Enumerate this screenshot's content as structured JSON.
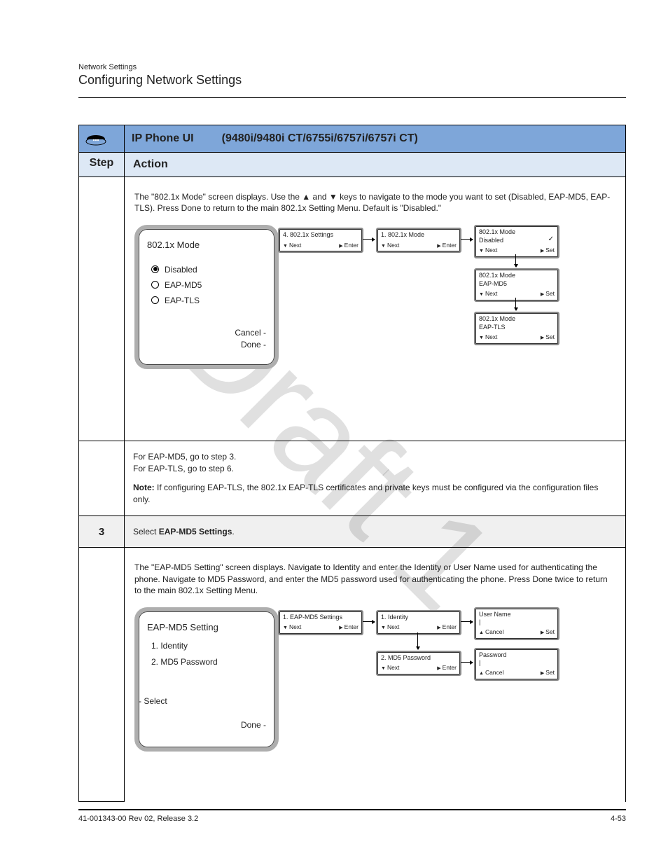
{
  "header": {
    "breadcrumb": "Network Settings",
    "title": "Configuring Network Settings",
    "hr": true
  },
  "table": {
    "mainTitle": "IP Phone UI         (9480i/9480i CT/6755i/6757i/6757i CT)",
    "stepHdr": "Step",
    "actionHdr": "Action"
  },
  "row1": {
    "intro": "The \"802.1x Mode\" screen displays. Use the ▲ and ▼ keys to navigate to the mode you want to set (Disabled, EAP-MD5, EAP-TLS). Press Done to return to the main 802.1x Setting Menu. Default is \"Disabled.\"",
    "screen": {
      "title": "802.1x Mode",
      "opts": [
        "Disabled",
        "EAP-MD5",
        "EAP-TLS"
      ],
      "cancel": "Cancel -",
      "done": "Done -"
    },
    "flow": {
      "n1": {
        "title": "4.  802.1x Settings",
        "l": "Next",
        "r": "Enter"
      },
      "n2": {
        "title": "1.  802.1x Mode",
        "l": "Next",
        "r": "Enter"
      },
      "n3": {
        "title": "802.1x Mode",
        "sub": "Disabled",
        "check": "✓",
        "l": "Next",
        "r": "Set"
      },
      "n4": {
        "title": "802.1x Mode",
        "sub": "EAP-MD5",
        "l": "Next",
        "r": "Set"
      },
      "n5": {
        "title": "802.1x Mode",
        "sub": "EAP-TLS",
        "l": "Next",
        "r": "Set"
      }
    }
  },
  "rowMid": {
    "text": "For EAP-MD5, go to step 3.\nFor EAP-TLS, go to step 6.",
    "noteLead": "Note: ",
    "noteBody": "If configuring EAP-TLS, the 802.1x EAP-TLS certificates and private keys must be configured via the configuration files only."
  },
  "rowGray": {
    "step": "3",
    "text": "Select EAP-MD5 Settings."
  },
  "row2": {
    "intro": "The \"EAP-MD5 Setting\" screen displays. Navigate to Identity and enter the Identity or User Name used for authenticating the phone. Navigate to MD5 Password, and enter the MD5 password used for authenticating the phone. Press Done twice to return to the main 802.1x Setting Menu.",
    "screen": {
      "title": "EAP-MD5 Setting",
      "items": [
        "1. Identity",
        "2. MD5 Password"
      ],
      "select": "- Select",
      "done": "Done -"
    },
    "flow": {
      "n1": {
        "title": "1.  EAP-MD5 Settings",
        "l": "Next",
        "r": "Enter"
      },
      "n2": {
        "title": "1. Identity",
        "l": "Next",
        "r": "Enter"
      },
      "n3": {
        "title": "User Name",
        "cursor": "|",
        "lUp": "Cancel",
        "r": "Set"
      },
      "n4": {
        "title": "2. MD5 Password",
        "l": "Next",
        "r": "Enter"
      },
      "n5": {
        "title": "Password",
        "cursor": "|",
        "lUp": "Cancel",
        "r": "Set"
      }
    }
  },
  "footer": {
    "left": "41-001343-00 Rev 02,  Release 3.2",
    "right": "4-53"
  },
  "watermark": "Draft 1"
}
